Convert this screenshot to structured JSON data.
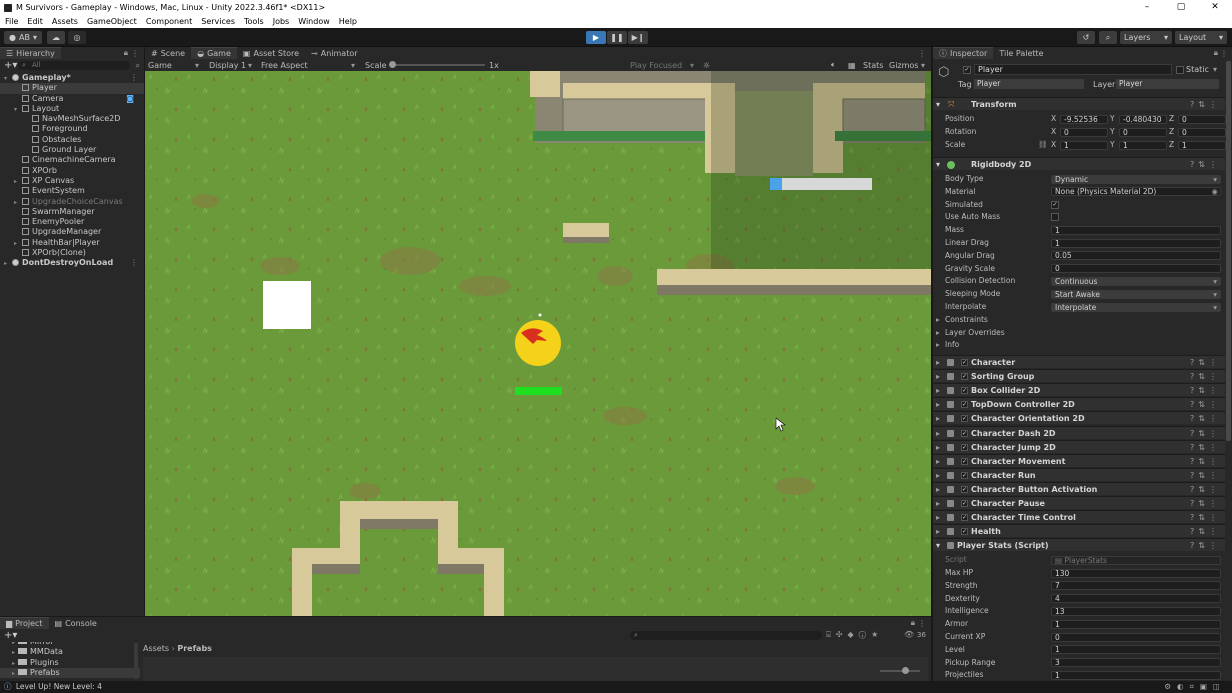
{
  "window": {
    "title": "M Survivors - Gameplay - Windows, Mac, Linux - Unity 2022.3.46f1* <DX11>"
  },
  "menu": [
    "File",
    "Edit",
    "Assets",
    "GameObject",
    "Component",
    "Services",
    "Tools",
    "Jobs",
    "Window",
    "Help"
  ],
  "toolbar": {
    "account": "AB",
    "layers": "Layers",
    "layout": "Layout"
  },
  "hierarchy": {
    "tab": "Hierarchy",
    "search_placeholder": "All",
    "items": [
      {
        "label": "Gameplay*",
        "indent": 0
      },
      {
        "label": "Player",
        "indent": 1
      },
      {
        "label": "Camera",
        "indent": 1
      },
      {
        "label": "Layout",
        "indent": 1
      },
      {
        "label": "NavMeshSurface2D",
        "indent": 2
      },
      {
        "label": "Foreground",
        "indent": 2
      },
      {
        "label": "Obstacles",
        "indent": 2
      },
      {
        "label": "Ground Layer",
        "indent": 2
      },
      {
        "label": "CinemachineCamera",
        "indent": 1
      },
      {
        "label": "XPOrb",
        "indent": 1
      },
      {
        "label": "XP Canvas",
        "indent": 1
      },
      {
        "label": "EventSystem",
        "indent": 1
      },
      {
        "label": "UpgradeChoiceCanvas",
        "indent": 1
      },
      {
        "label": "SwarmManager",
        "indent": 1
      },
      {
        "label": "EnemyPooler",
        "indent": 1
      },
      {
        "label": "UpgradeManager",
        "indent": 1
      },
      {
        "label": "HealthBar|Player",
        "indent": 1
      },
      {
        "label": "XPOrb(Clone)",
        "indent": 1
      },
      {
        "label": "DontDestroyOnLoad",
        "indent": 0
      }
    ]
  },
  "game": {
    "tabs": [
      "Scene",
      "Game",
      "Asset Store",
      "Animator"
    ],
    "view": "Game",
    "display": "Display 1",
    "aspect": "Free Aspect",
    "scale_label": "Scale",
    "scale_value": "1x",
    "play_mode": "Play Focused",
    "stats": "Stats",
    "gizmos": "Gizmos"
  },
  "inspector": {
    "tabs": [
      "Inspector",
      "Tile Palette"
    ],
    "object_name": "Player",
    "static_label": "Static",
    "tag_label": "Tag",
    "tag_value": "Player",
    "layer_label": "Layer",
    "layer_value": "Player",
    "transform": {
      "title": "Transform",
      "position": {
        "label": "Position",
        "x": "-9.52536",
        "y": "-0.480430",
        "z": "0"
      },
      "rotation": {
        "label": "Rotation",
        "x": "0",
        "y": "0",
        "z": "0"
      },
      "scale": {
        "label": "Scale",
        "x": "1",
        "y": "1",
        "z": "1"
      }
    },
    "rigidbody": {
      "title": "Rigidbody 2D",
      "fields": [
        {
          "label": "Body Type",
          "value": "Dynamic",
          "kind": "dropdown"
        },
        {
          "label": "Material",
          "value": "None (Physics Material 2D)",
          "kind": "object"
        },
        {
          "label": "Simulated",
          "value": "✓",
          "kind": "check"
        },
        {
          "label": "Use Auto Mass",
          "value": "",
          "kind": "check"
        },
        {
          "label": "Mass",
          "value": "1",
          "kind": "field"
        },
        {
          "label": "Linear Drag",
          "value": "1",
          "kind": "field"
        },
        {
          "label": "Angular Drag",
          "value": "0.05",
          "kind": "field"
        },
        {
          "label": "Gravity Scale",
          "value": "0",
          "kind": "field"
        },
        {
          "label": "Collision Detection",
          "value": "Continuous",
          "kind": "dropdown"
        },
        {
          "label": "Sleeping Mode",
          "value": "Start Awake",
          "kind": "dropdown"
        },
        {
          "label": "Interpolate",
          "value": "Interpolate",
          "kind": "dropdown"
        }
      ],
      "foldouts": [
        "Constraints",
        "Layer Overrides",
        "Info"
      ]
    },
    "components": [
      "Character",
      "Sorting Group",
      "Box Collider 2D",
      "TopDown Controller 2D",
      "Character Orientation 2D",
      "Character Dash 2D",
      "Character Jump 2D",
      "Character Movement",
      "Character Run",
      "Character Button Activation",
      "Character Pause",
      "Character Time Control",
      "Health"
    ],
    "player_stats": {
      "title": "Player Stats (Script)",
      "script_label": "Script",
      "script_value": "PlayerStats",
      "fields": [
        {
          "label": "Max HP",
          "value": "130"
        },
        {
          "label": "Strength",
          "value": "7"
        },
        {
          "label": "Dexterity",
          "value": "4"
        },
        {
          "label": "Intelligence",
          "value": "13"
        },
        {
          "label": "Armor",
          "value": "1"
        },
        {
          "label": "Current XP",
          "value": "0"
        },
        {
          "label": "Level",
          "value": "1"
        },
        {
          "label": "Pickup Range",
          "value": "3"
        },
        {
          "label": "Projectiles",
          "value": "1"
        }
      ]
    }
  },
  "project": {
    "tabs": [
      "Project",
      "Console"
    ],
    "folders": [
      "Mirror",
      "MMData",
      "Plugins",
      "Prefabs"
    ],
    "breadcrumb": [
      "Assets",
      "Prefabs"
    ],
    "count": "36"
  },
  "status": "Level Up! New Level: 4",
  "colors": {
    "grass": "#6a9a3a",
    "player": "#f5d21a",
    "health": "#1ee01e",
    "xpbar": "#4aa3e8"
  }
}
